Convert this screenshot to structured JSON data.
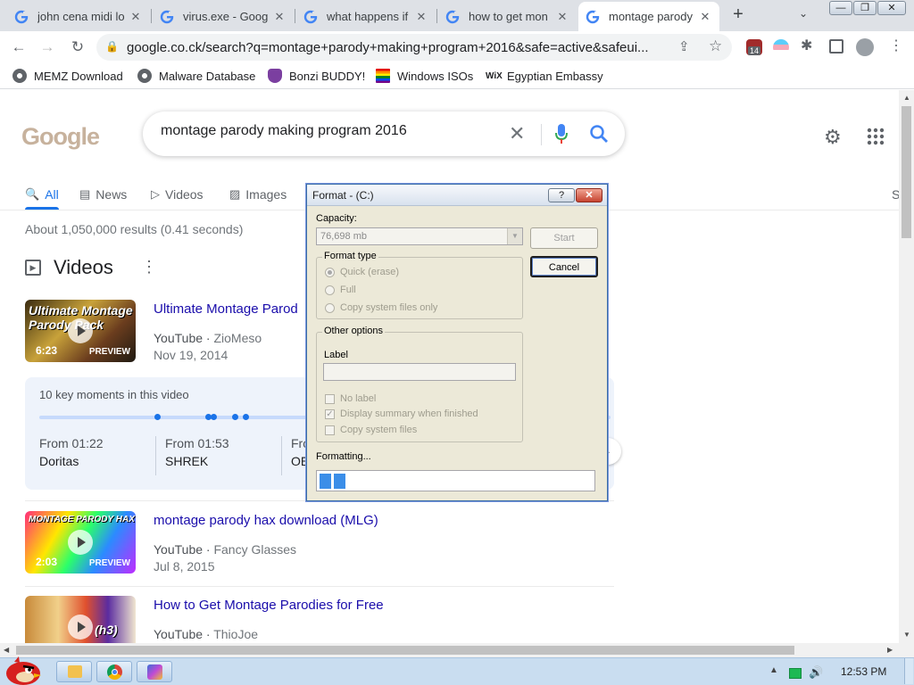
{
  "browser": {
    "tabs": [
      {
        "title": "john cena midi lo",
        "favicon": "google-g-icon"
      },
      {
        "title": "virus.exe - Goog",
        "favicon": "google-g-icon"
      },
      {
        "title": "what happens if",
        "favicon": "google-g-icon"
      },
      {
        "title": "how to get mon",
        "favicon": "google-g-icon"
      },
      {
        "title": "montage parody",
        "favicon": "google-g-icon",
        "active": true
      }
    ],
    "tab_close_glyph": "✕",
    "new_tab_glyph": "+",
    "tab_search_glyph": "⌄",
    "window_controls": {
      "minimize": "—",
      "maximize": "❐",
      "close": "✕"
    },
    "back_glyph": "←",
    "forward_glyph": "→",
    "reload_glyph": "↻",
    "url": "google.co.ck/search?q=montage+parody+making+program+2016&safe=active&safeui...",
    "extension_badge": "14",
    "bookmarks": [
      {
        "label": "MEMZ Download",
        "icon": "globe-icon"
      },
      {
        "label": "Malware Database",
        "icon": "globe-icon"
      },
      {
        "label": "Bonzi BUDDY!",
        "icon": "bonzi-icon"
      },
      {
        "label": "Windows ISOs",
        "icon": "rainbow-flag-icon"
      },
      {
        "label": "Egyptian Embassy",
        "icon": "wix-icon"
      }
    ],
    "wix_glyph": "WiX"
  },
  "google": {
    "logo_text": "Google",
    "query": "montage parody making program 2016",
    "clear_glyph": "✕",
    "settings_glyph": "⚙",
    "tabs": [
      {
        "label": "All",
        "icon": "search-icon",
        "glyph": "🔍",
        "active": true
      },
      {
        "label": "News",
        "icon": "news-icon",
        "glyph": "▤"
      },
      {
        "label": "Videos",
        "icon": "video-icon",
        "glyph": "▷"
      },
      {
        "label": "Images",
        "icon": "image-icon",
        "glyph": "▨"
      },
      {
        "label": "S",
        "icon": "",
        "glyph": ""
      }
    ],
    "result_stats": "About 1,050,000 results (0.41 seconds)",
    "videos_heading": "Videos",
    "kebab_glyph": "⋮",
    "videos": [
      {
        "title": "Ultimate Montage Parod",
        "source": "YouTube",
        "channel": "ZioMeso",
        "date": "Nov 19, 2014",
        "duration": "6:23",
        "preview": "PREVIEW",
        "thumb_caption": "Ultimate Montage Parody Pack"
      },
      {
        "title": "montage parody hax download (MLG)",
        "source": "YouTube",
        "channel": "Fancy Glasses",
        "date": "Jul 8, 2015",
        "duration": "2:03",
        "preview": "PREVIEW",
        "thumb_caption": "MONTAGE PARODY HAX"
      },
      {
        "title": "How to Get Montage Parodies for Free",
        "source": "YouTube",
        "channel": "ThioJoe",
        "date": "",
        "duration": "",
        "preview": "",
        "thumb_caption": "(h3)"
      }
    ],
    "key_moments": {
      "title": "10 key moments in this video",
      "moments": [
        {
          "time": "From 01:22",
          "label": "Doritas"
        },
        {
          "time": "From 01:53",
          "label": "SHREK"
        },
        {
          "time": "Fro",
          "label": "OE"
        }
      ]
    },
    "carousel_next_glyph": "›"
  },
  "format_dialog": {
    "title": "Format -  (C:)",
    "help_glyph": "?",
    "close_glyph": "✕",
    "capacity_label": "Capacity:",
    "capacity_value": "76,698 mb",
    "combo_arrow_glyph": "▼",
    "start_label": "Start",
    "cancel_label": "Cancel",
    "format_type_label": "Format type",
    "options": [
      {
        "label": "Quick (erase)",
        "selected": true
      },
      {
        "label": "Full",
        "selected": false
      },
      {
        "label": "Copy system files only",
        "selected": false
      }
    ],
    "other_options_label": "Other options",
    "label_label": "Label",
    "label_value": "",
    "checkboxes": [
      {
        "label": "No label",
        "checked": false
      },
      {
        "label": "Display summary when finished",
        "checked": true
      },
      {
        "label": "Copy system files",
        "checked": false
      }
    ],
    "check_glyph": "✓",
    "status": "Formatting...",
    "progress_fraction": 0.1
  },
  "taskbar": {
    "clock": "12:53 PM",
    "speaker_glyph": "🔊"
  },
  "colors": {
    "link": "#1a0dab",
    "accent": "#1a73e8",
    "dialog_bg": "#ece9d8",
    "progress": "#3b8ee8",
    "taskbar": "#c9ddf0"
  }
}
